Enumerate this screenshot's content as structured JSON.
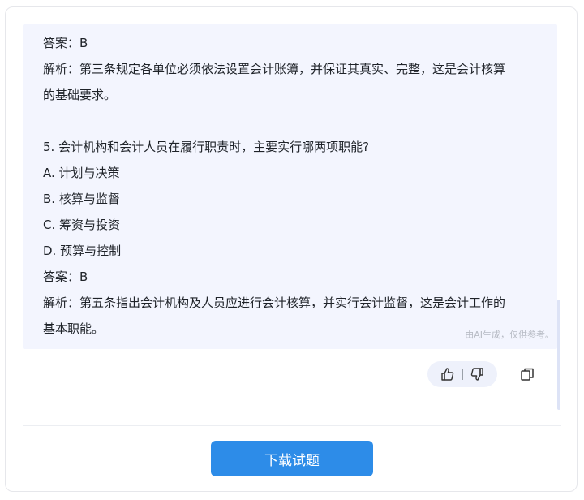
{
  "content": {
    "lines": [
      "答案：B",
      "解析：第三条规定各单位必须依法设置会计账簿，并保证其真实、完整，这是会计核算",
      "的基础要求。",
      "5. 会计机构和会计人员在履行职责时，主要实行哪两项职能?",
      "A. 计划与决策",
      "B. 核算与监督",
      "C. 筹资与投资",
      "D. 预算与控制",
      "答案：B",
      "解析：第五条指出会计机构及人员应进行会计核算，并实行会计监督，这是会计工作的",
      "基本职能。"
    ],
    "disclaimer": "由AI生成，仅供参考。"
  },
  "actions": {
    "like_icon": "thumbs-up-icon",
    "dislike_icon": "thumbs-down-icon",
    "copy_icon": "copy-icon"
  },
  "footer": {
    "download_label": "下载试题",
    "accent_color": "#2d8ce8"
  }
}
